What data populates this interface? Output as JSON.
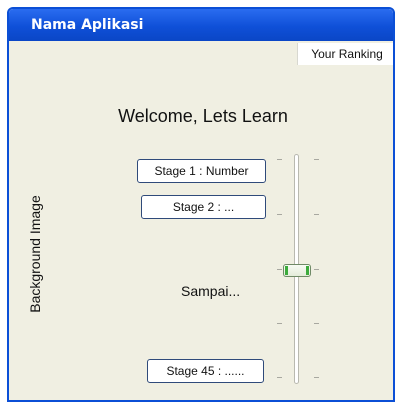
{
  "window": {
    "title": "Nama Aplikasi"
  },
  "header": {
    "ranking_label": "Your Ranking"
  },
  "main": {
    "welcome": "Welcome, Lets Learn",
    "background_label": "Background Image",
    "stages": [
      {
        "label": "Stage 1 : Number"
      },
      {
        "label": "Stage 2 : ..."
      },
      {
        "label": "Stage 45 : ......"
      }
    ],
    "ellipsis_text": "Sampai..."
  },
  "slider": {
    "level": 0.5
  },
  "colors": {
    "title_bar": "#0f50d8",
    "window_bg": "#f0efe2",
    "thumb_grip": "#3cab3c"
  }
}
